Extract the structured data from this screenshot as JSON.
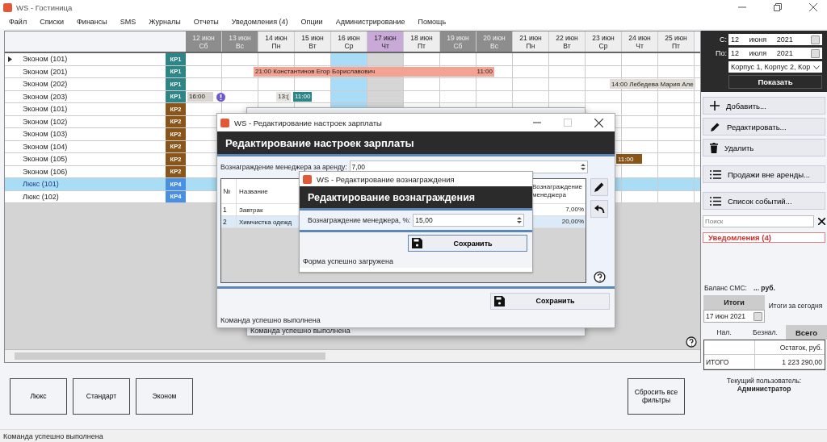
{
  "window": {
    "title": "WS - Гостиница"
  },
  "menu": [
    "Файл",
    "Списки",
    "Финансы",
    "SMS",
    "Журналы",
    "Отчеты",
    "Уведомления (4)",
    "Опции",
    "Администрирование",
    "Помощь"
  ],
  "days": [
    {
      "date": "12 июн",
      "weekday": "Сб",
      "weekend": true,
      "today": false,
      "selected": false
    },
    {
      "date": "13 июн",
      "weekday": "Вс",
      "weekend": true,
      "today": false,
      "selected": false
    },
    {
      "date": "14 июн",
      "weekday": "Пн",
      "weekend": false,
      "today": false,
      "selected": false
    },
    {
      "date": "15 июн",
      "weekday": "Вт",
      "weekend": false,
      "today": false,
      "selected": false
    },
    {
      "date": "16 июн",
      "weekday": "Ср",
      "weekend": false,
      "today": false,
      "selected": true
    },
    {
      "date": "17 июн",
      "weekday": "Чт",
      "weekend": false,
      "today": true,
      "selected": false
    },
    {
      "date": "18 июн",
      "weekday": "Пт",
      "weekend": false,
      "today": false,
      "selected": false
    },
    {
      "date": "19 июн",
      "weekday": "Сб",
      "weekend": true,
      "today": false,
      "selected": false
    },
    {
      "date": "20 июн",
      "weekday": "Вс",
      "weekend": true,
      "today": false,
      "selected": false
    },
    {
      "date": "21 июн",
      "weekday": "Пн",
      "weekend": false,
      "today": false,
      "selected": false
    },
    {
      "date": "22 июн",
      "weekday": "Вт",
      "weekend": false,
      "today": false,
      "selected": false
    },
    {
      "date": "23 июн",
      "weekday": "Ср",
      "weekend": false,
      "today": false,
      "selected": false
    },
    {
      "date": "24 июн",
      "weekday": "Чт",
      "weekend": false,
      "today": false,
      "selected": false
    },
    {
      "date": "25 июн",
      "weekday": "Пт",
      "weekend": false,
      "today": false,
      "selected": false
    }
  ],
  "rooms": [
    {
      "name": "Эконом (101)",
      "tag": "КР1",
      "color": "#2e8587",
      "selected": false,
      "current": true
    },
    {
      "name": "Эконом (201)",
      "tag": "КР1",
      "color": "#2e8587",
      "selected": false,
      "current": false,
      "bookings": [
        {
          "label": "21:00 Константинов Егор Бориславович",
          "end_label": "11:00",
          "color": "#f4a393",
          "alert": false
        }
      ]
    },
    {
      "name": "Эконом (202)",
      "tag": "КР1",
      "color": "#2e8587",
      "selected": false,
      "current": false,
      "bookings": [
        {
          "label": "14:00 Лебедева Мария Але",
          "color": "#e0ddd8",
          "alert": false
        }
      ]
    },
    {
      "name": "Эконом (203)",
      "tag": "КР1",
      "color": "#2e8587",
      "selected": false,
      "current": false,
      "bookings": [
        {
          "label": "16:00",
          "color": "#d8d4cf",
          "alert": true
        },
        {
          "label": "13:(",
          "color": "#e6e3df",
          "alert": false
        },
        {
          "label": "11:00",
          "color": "#2e8587",
          "alert": false
        }
      ]
    },
    {
      "name": "Эконом (101)",
      "tag": "КР2",
      "color": "#8a5518",
      "selected": false,
      "current": false
    },
    {
      "name": "Эконом (102)",
      "tag": "КР2",
      "color": "#8a5518",
      "selected": false,
      "current": false
    },
    {
      "name": "Эконом (103)",
      "tag": "КР2",
      "color": "#8a5518",
      "selected": false,
      "current": false
    },
    {
      "name": "Эконом (104)",
      "tag": "КР2",
      "color": "#8a5518",
      "selected": false,
      "current": false
    },
    {
      "name": "Эконом (105)",
      "tag": "КР2",
      "color": "#8a5518",
      "selected": false,
      "current": false,
      "bookings": [
        {
          "label": "11:00",
          "color": "#8a5518",
          "alert": false
        }
      ]
    },
    {
      "name": "Эконом (106)",
      "tag": "КР2",
      "color": "#8a5518",
      "selected": false,
      "current": false
    },
    {
      "name": "Люкс (101)",
      "tag": "КР4",
      "color": "#4a90e2",
      "selected": true,
      "current": false
    },
    {
      "name": "Люкс (102)",
      "tag": "КР4",
      "color": "#4a90e2",
      "selected": false,
      "current": false
    }
  ],
  "filter_buttons": [
    "Люкс",
    "Стандарт",
    "Эконом"
  ],
  "reset_button": "Сбросить все фильтры",
  "status_bar": "Команда успешно выполнена",
  "side_panel": {
    "from_label": "С:",
    "from_date": "12 июня 2021",
    "to_label": "По:",
    "to_date": "12 июля 2021",
    "buildings": "Корпус 1, Корпус 2, Кор",
    "show_button": "Показать",
    "actions": [
      {
        "label": "Добавить...",
        "kind": "plus"
      },
      {
        "label": "Редактировать...",
        "kind": "pencil"
      },
      {
        "label": "Удалить",
        "kind": "trash"
      },
      {
        "label": "Продажи вне аренды...",
        "kind": "list"
      },
      {
        "label": "Список событий...",
        "kind": "list"
      }
    ],
    "search_placeholder": "Поиск",
    "notifications": "Уведомления (4)",
    "sms_balance_label": "Баланс СМС:",
    "sms_balance": "... руб.",
    "totals_tab": "Итоги",
    "totals_today": "Итоги за сегодня",
    "totals_date": "17 июн 2021",
    "pay_tabs": [
      {
        "label": "Нал.",
        "selected": false
      },
      {
        "label": "Безнал.",
        "selected": false
      },
      {
        "label": "Всего",
        "selected": true
      }
    ],
    "totals_table": {
      "column_2": "Остаток, руб.",
      "rows": [
        {
          "label": "ИТОГО",
          "value": "1 223 290,00"
        }
      ]
    },
    "current_user_label": "Текущий пользователь:",
    "current_user": "Администратор"
  },
  "back_dialog": {
    "status": "Команда успешно выполнена"
  },
  "salary_dialog": {
    "title": "WS - Редактирование настроек зарплаты",
    "heading": "Редактирование настроек зарплаты",
    "field_label": "Вознаграждение менеджера за аренду:",
    "field_value": "7,00",
    "columns": [
      "№",
      "Название",
      "Вознаграждение менеджера"
    ],
    "rows": [
      {
        "no": "1",
        "name": "Завтрак",
        "reward": "7,00%",
        "selected": false
      },
      {
        "no": "2",
        "name": "Химчистка одежд",
        "reward": "20,00%",
        "selected": true
      }
    ],
    "save_button": "Сохранить",
    "status": "Команда успешно выполнена"
  },
  "reward_dialog": {
    "title": "WS - Редактирование вознаграждения",
    "heading": "Редактирование вознаграждения",
    "field_label": "Вознаграждение менеджера, %:",
    "field_value": "15,00",
    "save_button": "Сохранить",
    "status": "Форма успешно загружена"
  }
}
